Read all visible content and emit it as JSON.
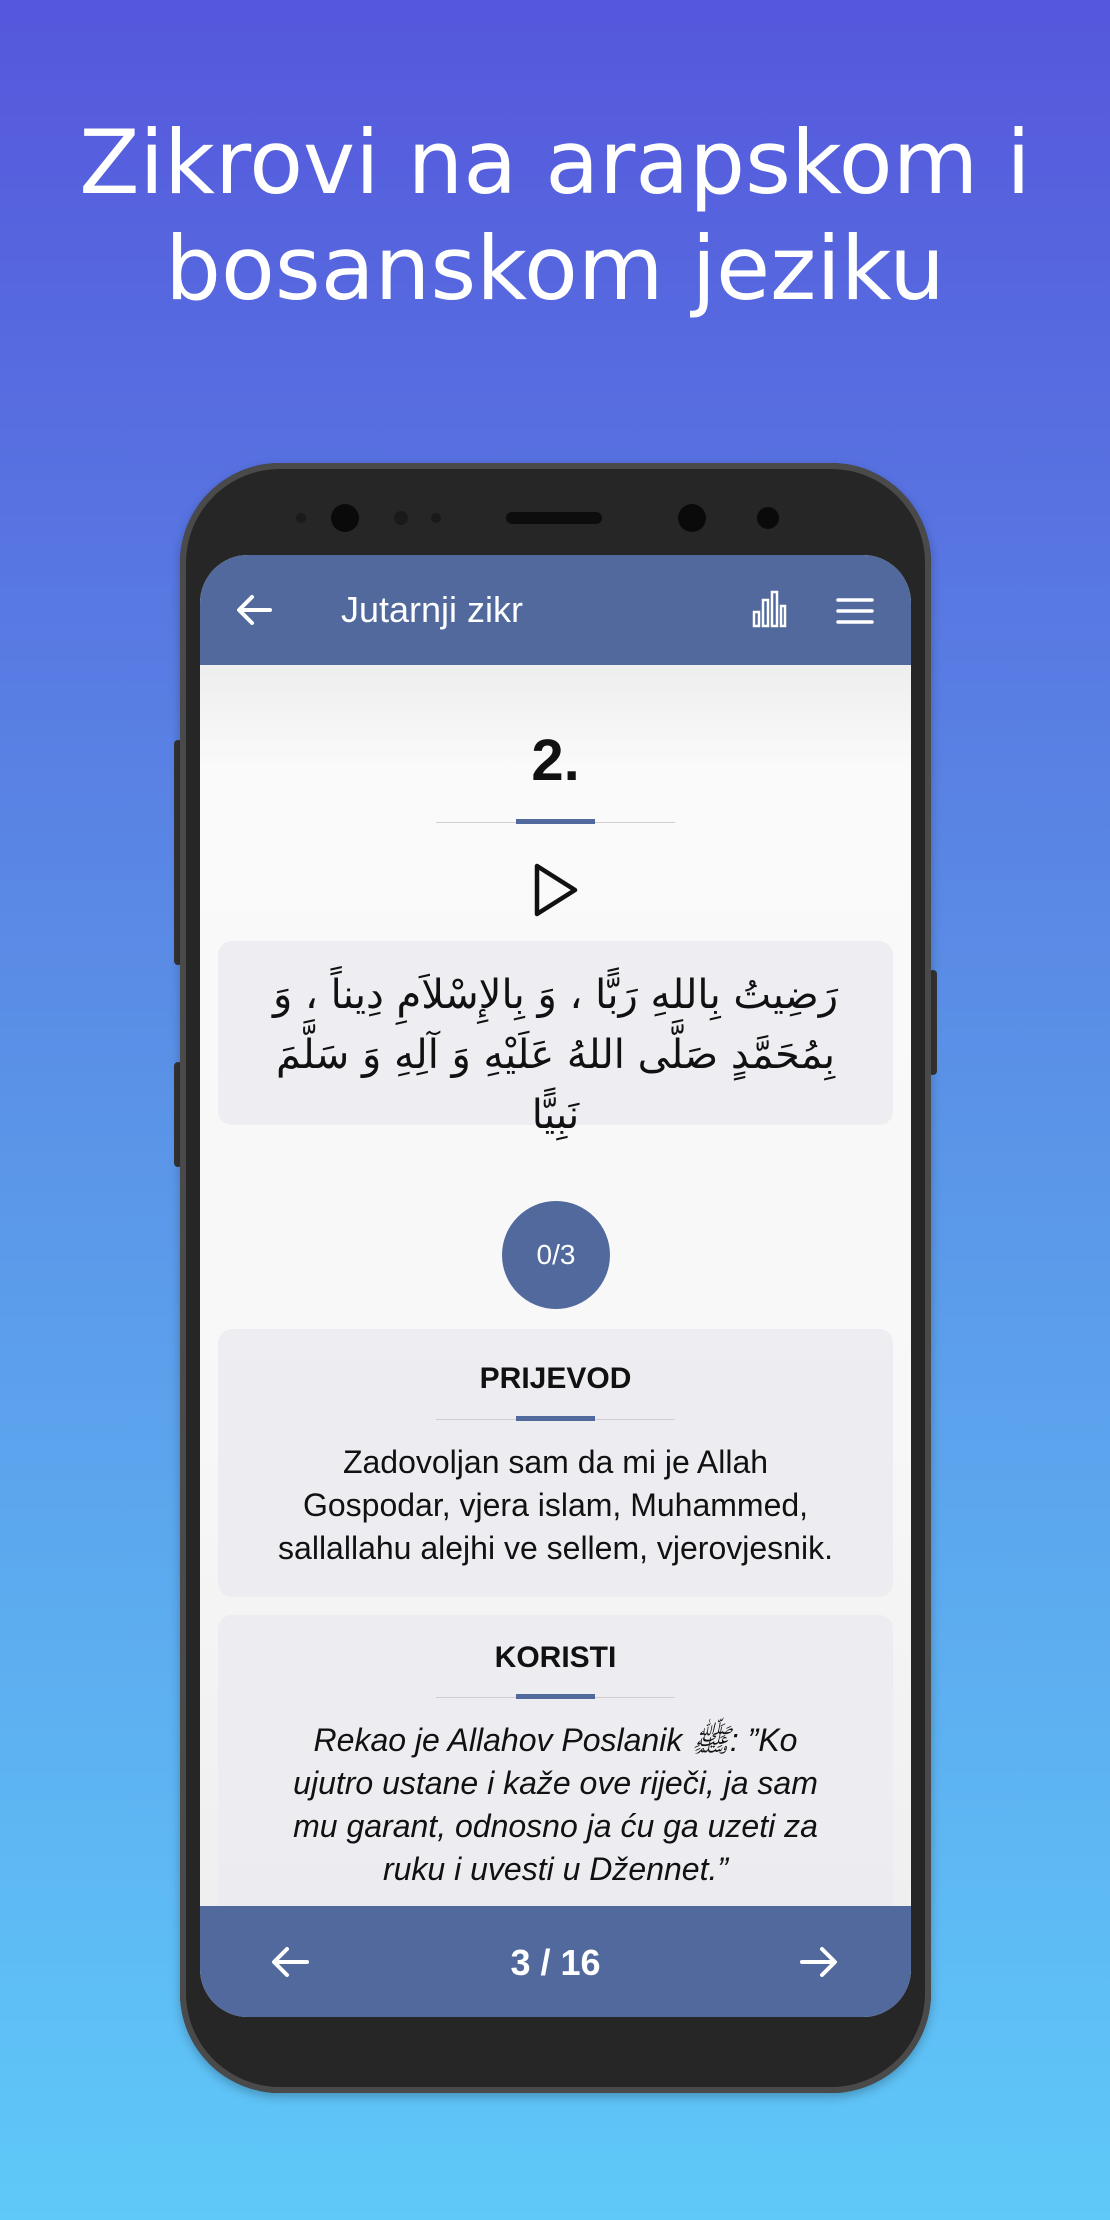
{
  "headline": {
    "line1": "Zikrovi na arapskom i",
    "line2": "bosanskom jeziku"
  },
  "appbar": {
    "title": "Jutarnji zikr",
    "back_icon": "arrow-left-icon",
    "stats_icon": "bar-chart-icon",
    "menu_icon": "hamburger-menu-icon"
  },
  "zikr": {
    "number": "2.",
    "arabic_line1": "رَضِيتُ بِاللهِ رَبًّا ، وَ بِالإِسْلاَمِ دِيناً ، وَ",
    "arabic_line2": "بِمُحَمَّدٍ صَلَّى اللهُ عَلَيْهِ وَ آلِهِ وَ سَلَّمَ نَبِيًّا",
    "counter": "0/3"
  },
  "translation": {
    "title": "PRIJEVOD",
    "line1": "Zadovoljan sam da mi je Allah",
    "line2": "Gospodar, vjera islam, Muhammed,",
    "line3": "sallallahu alejhi ve sellem, vjerovjesnik."
  },
  "benefits": {
    "title": "KORISTI",
    "line1": "Rekao je Allahov Poslanik ﷺ: ”Ko",
    "line2": "ujutro ustane i kaže ove riječi, ja sam",
    "line3": "mu garant, odnosno ja ću ga uzeti za",
    "line4": "ruku i uvesti u Džennet.”"
  },
  "pager": {
    "label": "3 / 16"
  },
  "colors": {
    "accent": "#51699c",
    "background_top": "#5557dc",
    "background_bottom": "#5fc9f9"
  }
}
